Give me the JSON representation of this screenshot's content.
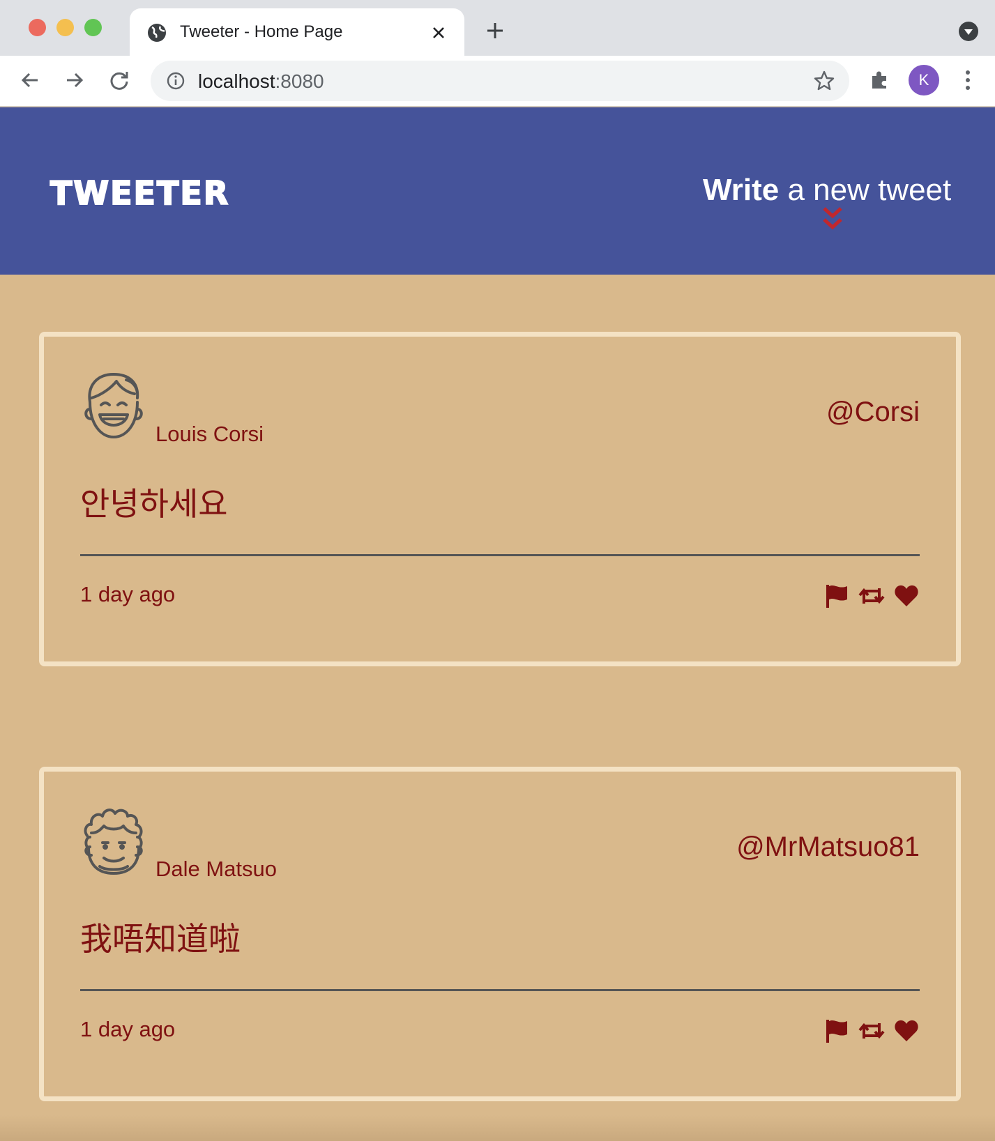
{
  "browser": {
    "tab_title": "Tweeter - Home Page",
    "url_host": "localhost",
    "url_port": ":8080",
    "profile_initial": "K"
  },
  "header": {
    "brand": "TWEETER",
    "write_bold": "Write",
    "write_rest": " a new tweet"
  },
  "tweets": [
    {
      "name": "Louis Corsi",
      "handle": "@Corsi",
      "content": "안녕하세요",
      "time": "1 day ago",
      "avatar": "laughing-face-avatar-icon"
    },
    {
      "name": "Dale Matsuo",
      "handle": "@MrMatsuo81",
      "content": "我唔知道啦",
      "time": "1 day ago",
      "avatar": "curly-hair-face-avatar-icon"
    }
  ],
  "colors": {
    "header_bg": "#45539a",
    "page_bg": "#d9b98c",
    "card_border": "#f4e2c4",
    "text_accent": "#7f1111",
    "chevron": "#c1272d"
  }
}
